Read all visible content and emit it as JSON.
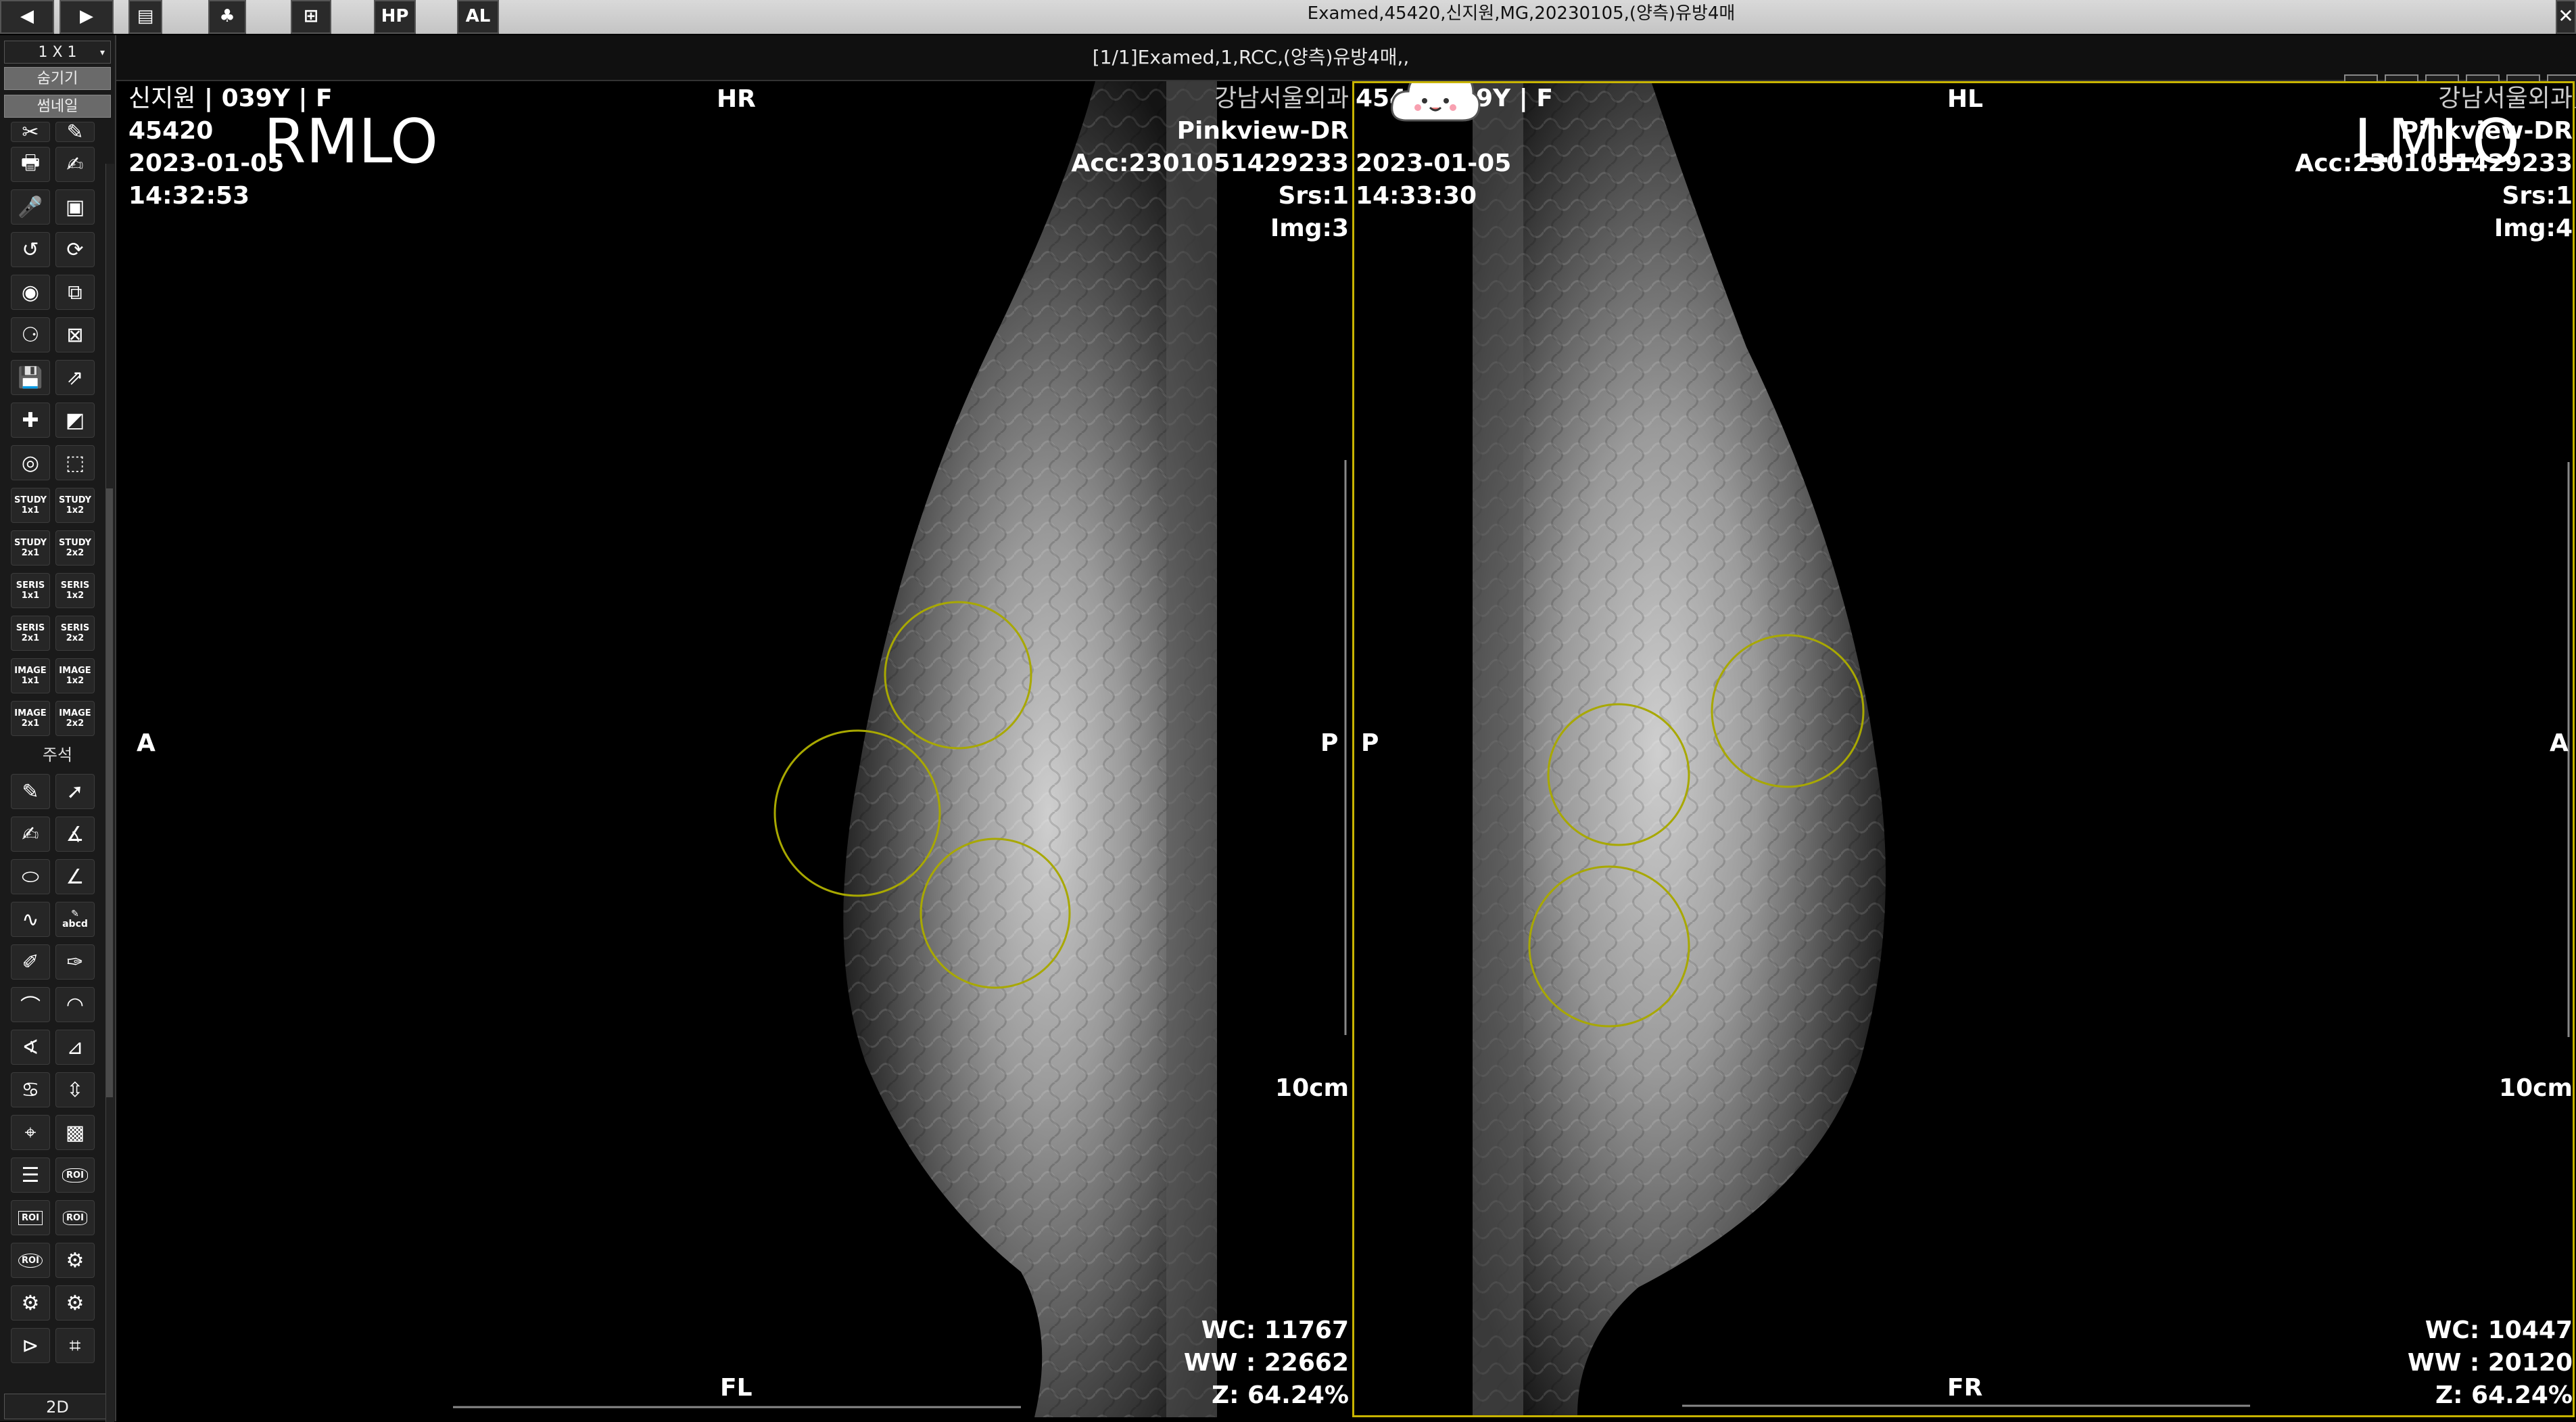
{
  "window": {
    "title": "Examed,45420,신지원,MG,20230105,(양측)유방4매",
    "series_info": "[1/1]Examed,1,RCC,(양측)유방4매,,",
    "top_buttons": [
      "HP",
      "AL"
    ],
    "right_icons": [
      "layout-icon",
      "layers-icon",
      "cine-icon",
      "grid-icon",
      "export-icon",
      "split-icon"
    ]
  },
  "toolbar": {
    "nav_prev": "◀",
    "nav_next": "▶",
    "layout_value": "1 X 1",
    "hide_label": "숨기기",
    "thumbnail_label": "썸네일",
    "annotation_label": "주석",
    "mode_label": "2D",
    "layout_buttons": [
      {
        "line1": "STUDY",
        "line2": "1x1"
      },
      {
        "line1": "STUDY",
        "line2": "1x2"
      },
      {
        "line1": "STUDY",
        "line2": "2x1"
      },
      {
        "line1": "STUDY",
        "line2": "2x2"
      },
      {
        "line1": "SERIS",
        "line2": "1x1"
      },
      {
        "line1": "SERIS",
        "line2": "1x2"
      },
      {
        "line1": "SERIS",
        "line2": "2x1"
      },
      {
        "line1": "SERIS",
        "line2": "2x2"
      },
      {
        "line1": "IMAGE",
        "line2": "1x1"
      },
      {
        "line1": "IMAGE",
        "line2": "1x2"
      },
      {
        "line1": "IMAGE",
        "line2": "2x1"
      },
      {
        "line1": "IMAGE",
        "line2": "2x2"
      }
    ],
    "annot_text_tool": "abcd",
    "roi_label": "ROI"
  },
  "left_view": {
    "patient": "신지원",
    "age_sex": "039Y | F",
    "patient_id": "45420",
    "date": "2023-01-05",
    "time": "14:32:53",
    "view_label": "RMLO",
    "top_orientation": "HR",
    "bottom_orientation": "FL",
    "left_orientation": "A",
    "right_orientation": "P",
    "institution": "강남서울외과",
    "device": "Pinkview-DR",
    "accession": "Acc:2301051429233",
    "series": "Srs:1",
    "image": "Img:3",
    "scale": "10cm",
    "wc": "WC: 11767",
    "ww": "WW : 22662",
    "zoom": "Z: 64.24%"
  },
  "right_view": {
    "patient_id_partial": "45420",
    "age_sex_partial": "9Y | F",
    "date": "2023-01-05",
    "time": "14:33:30",
    "view_label": "LMLO",
    "top_orientation": "HL",
    "bottom_orientation": "FR",
    "left_orientation": "P",
    "right_orientation": "A",
    "institution": "강남서울외과",
    "device": "Pinkview-DR",
    "accession": "Acc:2301051429233",
    "series": "Srs:1",
    "image": "Img:4",
    "scale": "10cm",
    "wc": "WC: 10447",
    "ww": "WW : 20120",
    "zoom": "Z: 64.24%"
  },
  "colors": {
    "active_border": "#c8b400",
    "annotation_circle": "#a8a800",
    "overlay_text": "#ffffff"
  }
}
